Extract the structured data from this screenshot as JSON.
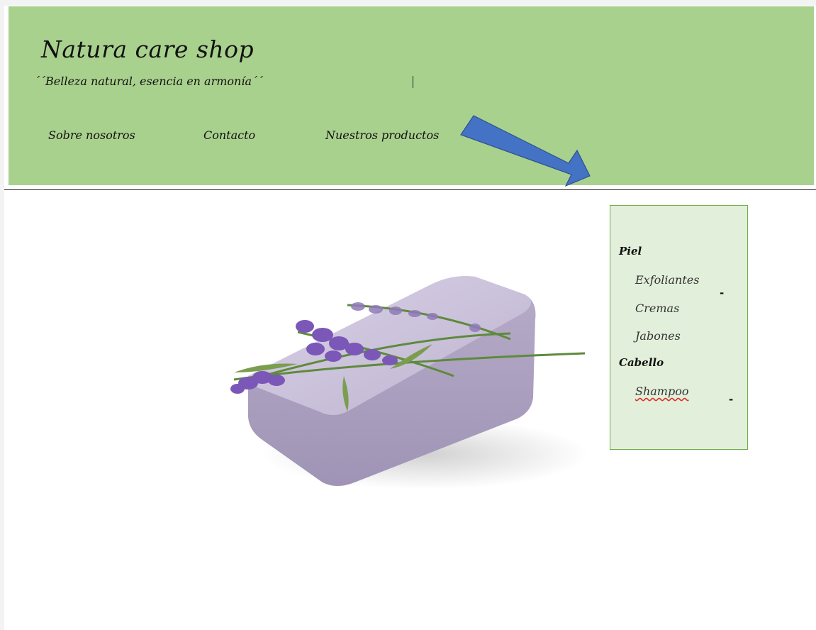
{
  "header": {
    "title": "Natura care shop",
    "slogan": "´´Belleza natural, esencia en armonía´´",
    "background_color": "#a9d18e"
  },
  "nav": {
    "items": [
      {
        "label": "Sobre nosotros"
      },
      {
        "label": "Contacto"
      },
      {
        "label": "Nuestros productos"
      }
    ]
  },
  "decoration": {
    "arrow_icon": "arrow-down-right",
    "arrow_color": "#4472c4"
  },
  "hero": {
    "image_icon": "lavender-soap-bar"
  },
  "product_menu": {
    "background_color": "#e2efda",
    "border_color": "#70ad47",
    "categories": [
      {
        "heading": "Piel",
        "items": [
          {
            "label": "Exfoliantes"
          },
          {
            "label": "Cremas"
          },
          {
            "label": "Jabones"
          }
        ]
      },
      {
        "heading": "Cabello",
        "items": [
          {
            "label": "Shampoo"
          }
        ]
      }
    ],
    "marks": [
      "-",
      "-"
    ]
  }
}
